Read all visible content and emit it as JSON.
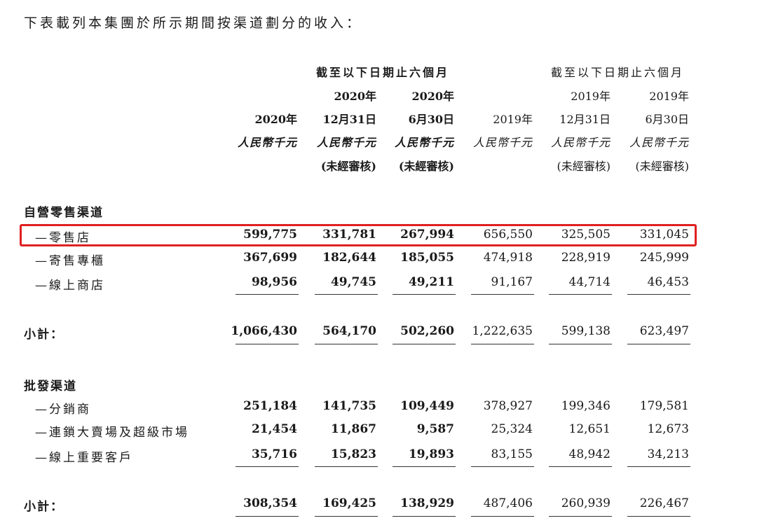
{
  "intro": "下表載列本集團於所示期間按渠道劃分的收入：",
  "header": {
    "span_2020": "截至以下日期止六個月",
    "span_2019": "截至以下日期止六個月",
    "columns": [
      {
        "year": "2020年",
        "date": "",
        "currency": "人民幣千元",
        "audit": ""
      },
      {
        "year": "2020年",
        "date": "12月31日",
        "currency": "人民幣千元",
        "audit": "(未經審核)"
      },
      {
        "year": "2020年",
        "date": "6月30日",
        "currency": "人民幣千元",
        "audit": "(未經審核)"
      },
      {
        "year": "2019年",
        "date": "",
        "currency": "人民幣千元",
        "audit": ""
      },
      {
        "year": "2019年",
        "date": "12月31日",
        "currency": "人民幣千元",
        "audit": "(未經審核)"
      },
      {
        "year": "2019年",
        "date": "6月30日",
        "currency": "人民幣千元",
        "audit": "(未經審核)"
      }
    ]
  },
  "sections": [
    {
      "title": "自營零售渠道",
      "rows": [
        {
          "label": "—零售店",
          "values": [
            "599,775",
            "331,781",
            "267,994",
            "656,550",
            "325,505",
            "331,045"
          ]
        },
        {
          "label": "—寄售專櫃",
          "values": [
            "367,699",
            "182,644",
            "185,055",
            "474,918",
            "228,919",
            "245,999"
          ]
        },
        {
          "label": "—線上商店",
          "values": [
            "98,956",
            "49,745",
            "49,211",
            "91,167",
            "44,714",
            "46,453"
          ]
        }
      ],
      "subtotal": {
        "label": "小計：",
        "values": [
          "1,066,430",
          "564,170",
          "502,260",
          "1,222,635",
          "599,138",
          "623,497"
        ]
      }
    },
    {
      "title": "批發渠道",
      "rows": [
        {
          "label": "—分銷商",
          "values": [
            "251,184",
            "141,735",
            "109,449",
            "378,927",
            "199,346",
            "179,581"
          ]
        },
        {
          "label": "—連鎖大賣場及超級市場",
          "values": [
            "21,454",
            "11,867",
            "9,587",
            "25,324",
            "12,651",
            "12,673"
          ]
        },
        {
          "label": "—線上重要客戶",
          "values": [
            "35,716",
            "15,823",
            "19,893",
            "83,155",
            "48,942",
            "34,213"
          ]
        }
      ],
      "subtotal": {
        "label": "小計：",
        "values": [
          "308,354",
          "169,425",
          "138,929",
          "487,406",
          "260,939",
          "226,467"
        ]
      }
    }
  ]
}
